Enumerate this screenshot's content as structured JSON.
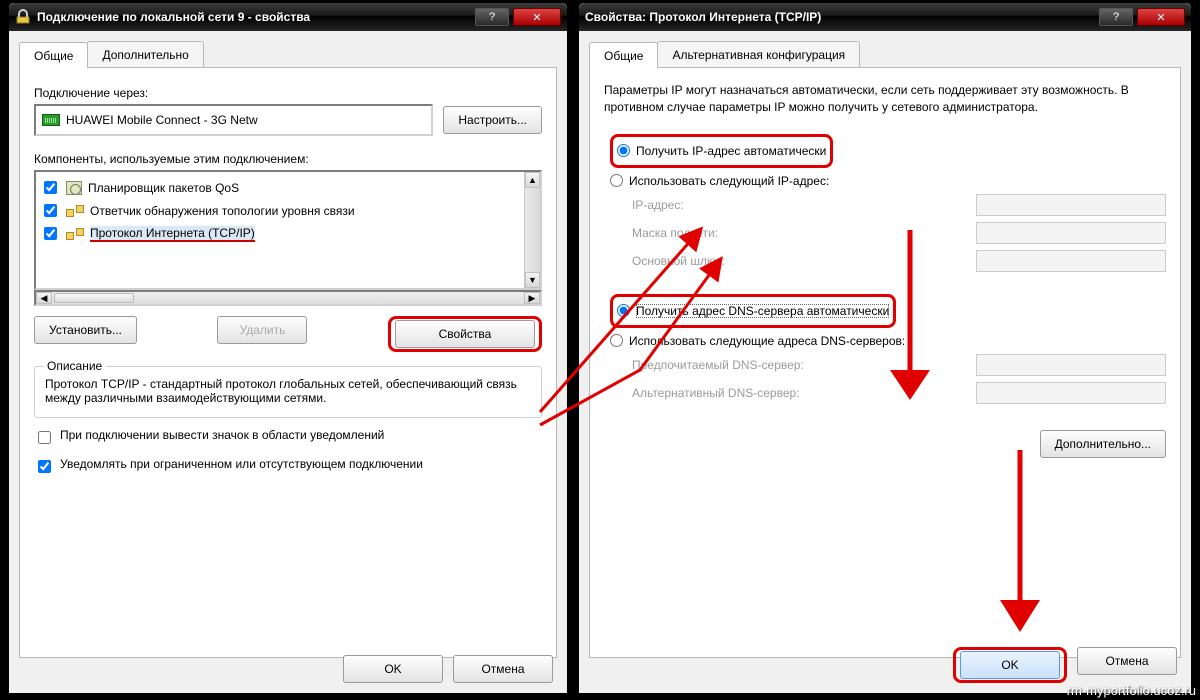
{
  "left": {
    "title": "Подключение по локальной сети 9 - свойства",
    "tabs": {
      "general": "Общие",
      "advanced": "Дополнительно"
    },
    "connect_via_label": "Подключение через:",
    "adapter": "HUAWEI Mobile Connect - 3G Netw",
    "configure_btn": "Настроить...",
    "components_label": "Компоненты, используемые этим подключением:",
    "items": [
      {
        "label": "Планировщик пакетов QoS",
        "checked": true
      },
      {
        "label": "Ответчик обнаружения топологии уровня связи",
        "checked": true
      },
      {
        "label": "Протокол Интернета (TCP/IP)",
        "checked": true
      }
    ],
    "install_btn": "Установить...",
    "uninstall_btn": "Удалить",
    "properties_btn": "Свойства",
    "desc_caption": "Описание",
    "desc_text": "Протокол TCP/IP - стандартный протокол глобальных сетей, обеспечивающий связь между различными взаимодействующими сетями.",
    "notify_checkbox": "При подключении вывести значок в области уведомлений",
    "limited_checkbox": "Уведомлять при ограниченном или отсутствующем подключении",
    "ok": "OK",
    "cancel": "Отмена"
  },
  "right": {
    "title": "Свойства: Протокол Интернета (TCP/IP)",
    "tabs": {
      "general": "Общие",
      "alt": "Альтернативная конфигурация"
    },
    "intro": "Параметры IP могут назначаться автоматически, если сеть поддерживает эту возможность. В противном случае параметры IP можно получить у сетевого администратора.",
    "ip_auto": "Получить IP-адрес автоматически",
    "ip_manual": "Использовать следующий IP-адрес:",
    "ip_addr_label": "IP-адрес:",
    "mask_label": "Маска подсети:",
    "gw_label": "Основной шлюз:",
    "dns_auto": "Получить адрес DNS-сервера автоматически",
    "dns_manual": "Использовать следующие адреса DNS-серверов:",
    "dns_pref_label": "Предпочитаемый DNS-сервер:",
    "dns_alt_label": "Альтернативный DNS-сервер:",
    "advanced_btn": "Дополнительно...",
    "ok": "OK",
    "cancel": "Отмена"
  },
  "watermark": "rm-myportfolio.ucoz.ru",
  "help_glyph": "?",
  "close_glyph": "✕"
}
